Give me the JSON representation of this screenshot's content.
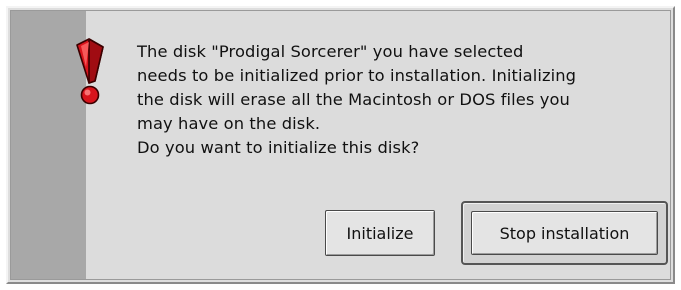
{
  "dialog": {
    "icon": "exclamation-alert-icon",
    "message_lines": [
      "The disk \"Prodigal Sorcerer\" you have selected",
      "needs to be initialized prior to installation. Initializing",
      "the disk will erase all the Macintosh or DOS files you",
      "may have on the disk.",
      "Do you want to initialize this disk?"
    ],
    "buttons": {
      "initialize": "Initialize",
      "stop_installation": "Stop installation"
    },
    "default_button": "stop_installation"
  },
  "colors": {
    "dialog_background": "#dcdcdc",
    "side_band": "#a8a8a8",
    "icon_red": "#d8141c"
  }
}
